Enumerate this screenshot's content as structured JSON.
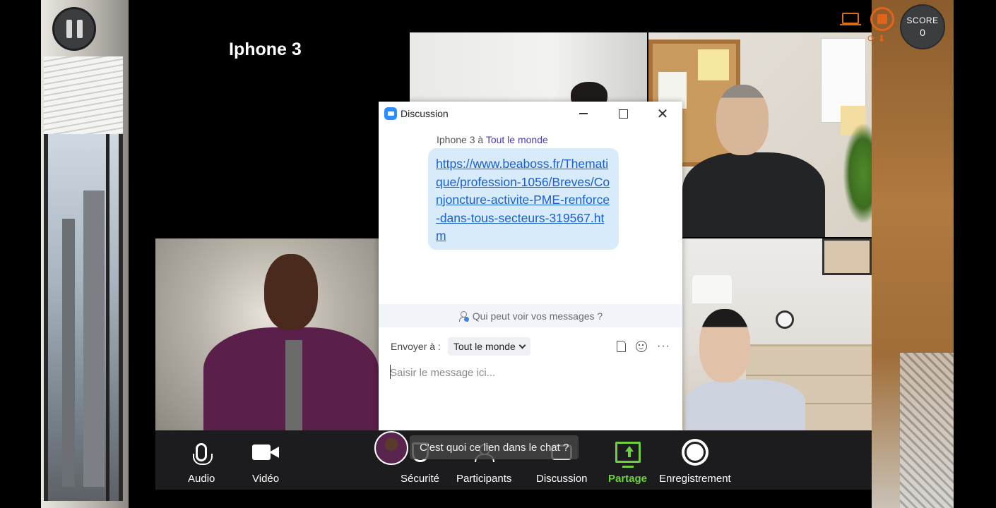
{
  "meeting": {
    "title": "Iphone 3"
  },
  "hud": {
    "score_label": "SCORE",
    "score_value": "0",
    "accent_color": "#e2641a"
  },
  "chat": {
    "window_title": "Discussion",
    "message": {
      "sender": "Iphone 3",
      "connector": "à",
      "recipient": "Tout le monde",
      "link": "https://www.beaboss.fr/Thematique/profession-1056/Breves/Conjoncture-activite-PME-renforce-dans-tous-secteurs-319567.htm"
    },
    "privacy_text": "Qui peut voir vos messages ?",
    "send_to_label": "Envoyer à :",
    "recipient_selected": "Tout le monde",
    "input_placeholder": "Saisir le message ici..."
  },
  "dialogue": {
    "prompt": "C'est quoi ce lien dans le chat ?"
  },
  "toolbar": {
    "audio": "Audio",
    "video": "Vidéo",
    "security": "Sécurité",
    "participants": "Participants",
    "chat": "Discussion",
    "share": "Partage",
    "record": "Enregistrement",
    "share_color": "#6fcf3f"
  }
}
